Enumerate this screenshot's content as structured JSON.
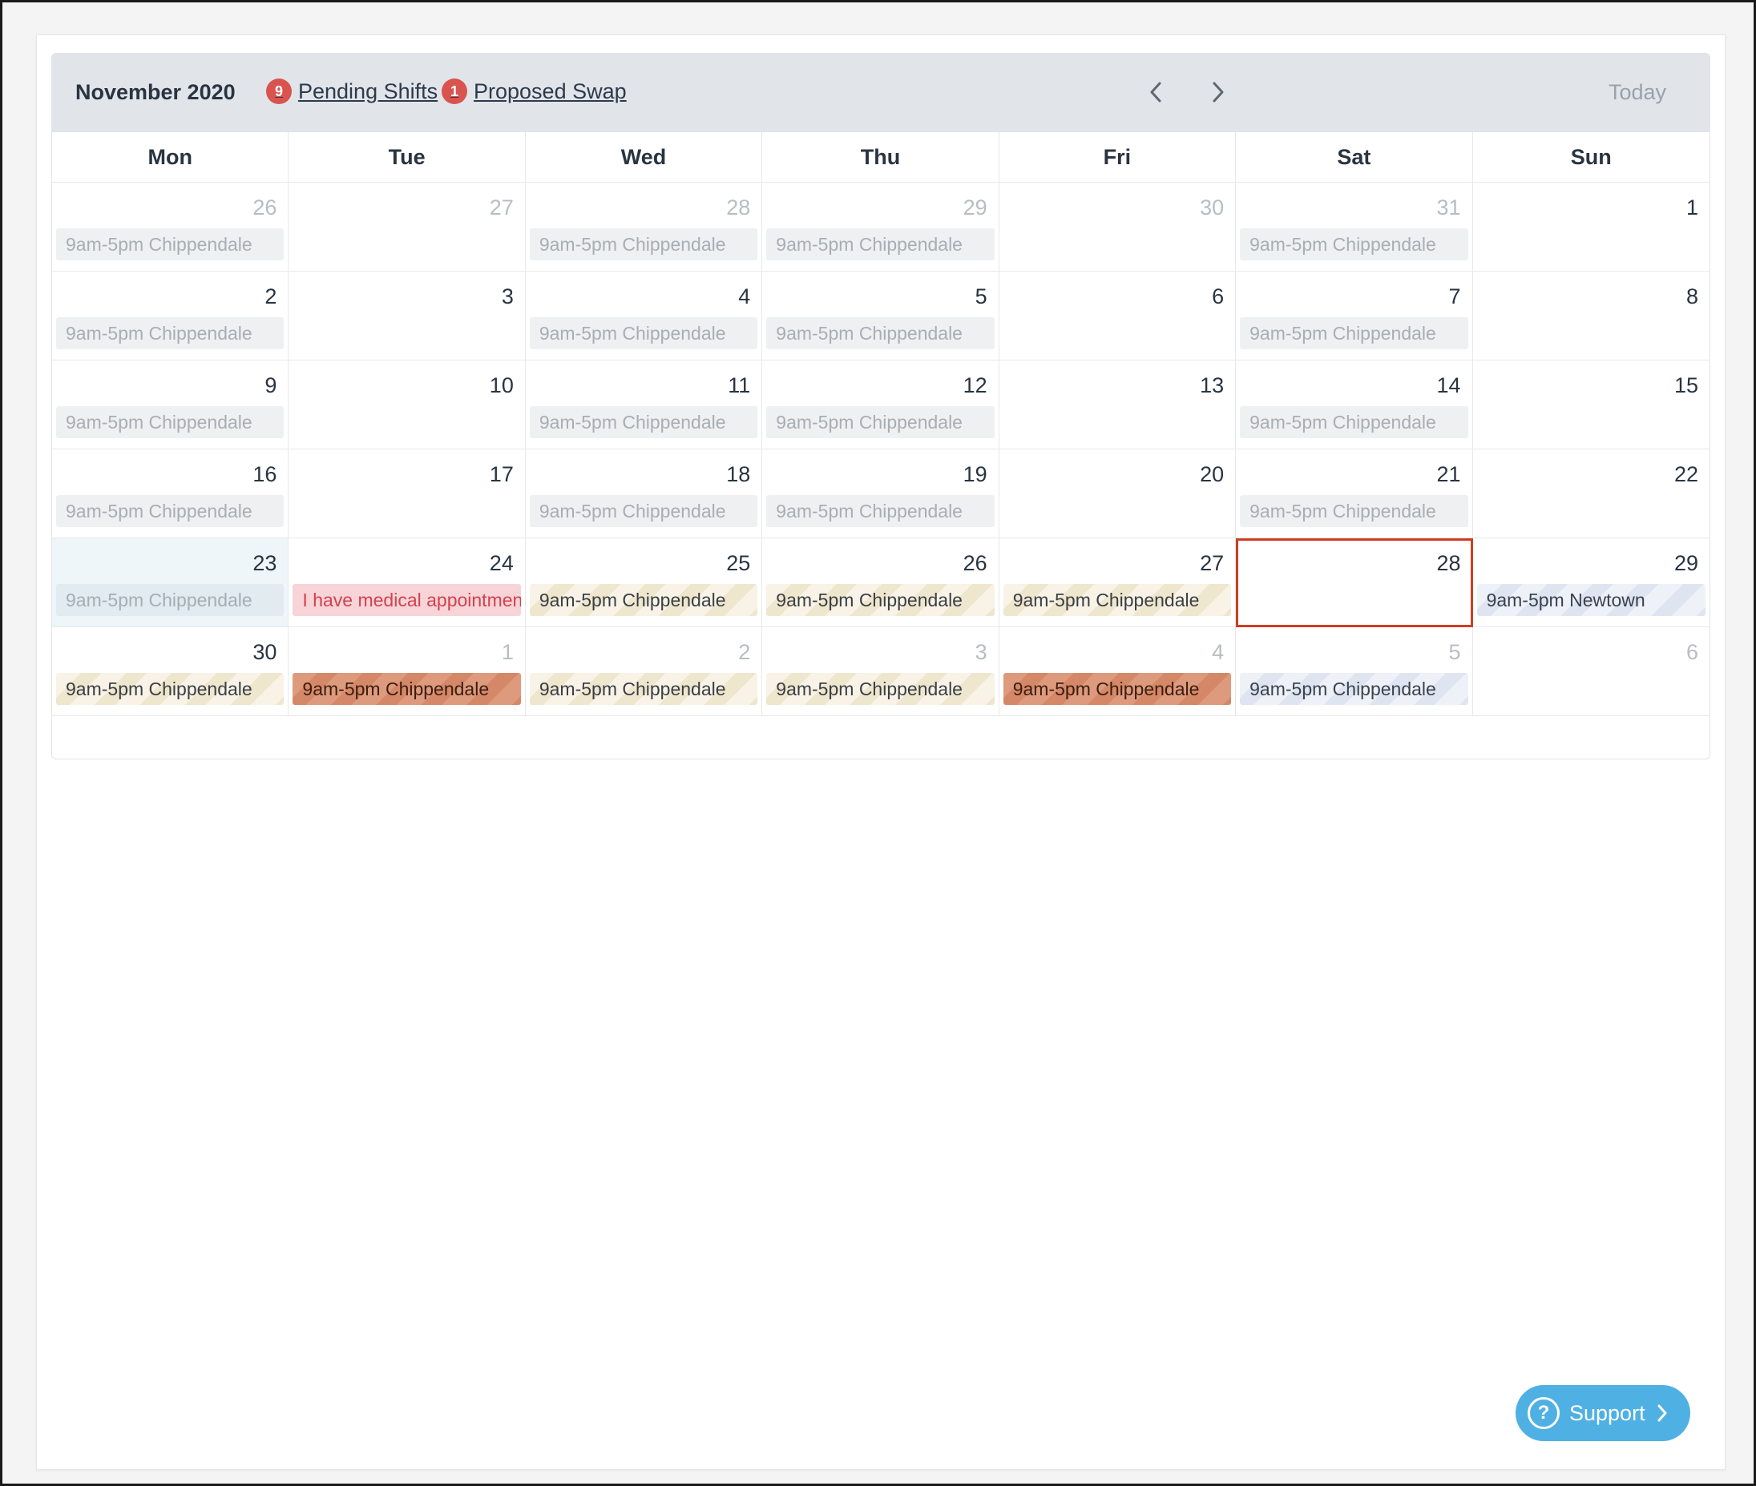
{
  "header": {
    "month_title": "November 2020",
    "pending": {
      "count": "9",
      "label": "Pending Shifts"
    },
    "proposed": {
      "count": "1",
      "label": "Proposed Swap"
    },
    "today_label": "Today"
  },
  "weekdays": [
    "Mon",
    "Tue",
    "Wed",
    "Thu",
    "Fri",
    "Sat",
    "Sun"
  ],
  "weeks": [
    [
      {
        "day": "26",
        "muted": true,
        "shift": "9am-5pm Chippendale",
        "kind": "past"
      },
      {
        "day": "27",
        "muted": true
      },
      {
        "day": "28",
        "muted": true,
        "shift": "9am-5pm Chippendale",
        "kind": "past"
      },
      {
        "day": "29",
        "muted": true,
        "shift": "9am-5pm Chippendale",
        "kind": "past"
      },
      {
        "day": "30",
        "muted": true
      },
      {
        "day": "31",
        "muted": true,
        "shift": "9am-5pm Chippendale",
        "kind": "past"
      },
      {
        "day": "1"
      }
    ],
    [
      {
        "day": "2",
        "shift": "9am-5pm Chippendale",
        "kind": "past"
      },
      {
        "day": "3"
      },
      {
        "day": "4",
        "shift": "9am-5pm Chippendale",
        "kind": "past"
      },
      {
        "day": "5",
        "shift": "9am-5pm Chippendale",
        "kind": "past"
      },
      {
        "day": "6"
      },
      {
        "day": "7",
        "shift": "9am-5pm Chippendale",
        "kind": "past"
      },
      {
        "day": "8"
      }
    ],
    [
      {
        "day": "9",
        "shift": "9am-5pm Chippendale",
        "kind": "past"
      },
      {
        "day": "10"
      },
      {
        "day": "11",
        "shift": "9am-5pm Chippendale",
        "kind": "past"
      },
      {
        "day": "12",
        "shift": "9am-5pm Chippendale",
        "kind": "past"
      },
      {
        "day": "13"
      },
      {
        "day": "14",
        "shift": "9am-5pm Chippendale",
        "kind": "past"
      },
      {
        "day": "15"
      }
    ],
    [
      {
        "day": "16",
        "shift": "9am-5pm Chippendale",
        "kind": "past"
      },
      {
        "day": "17"
      },
      {
        "day": "18",
        "shift": "9am-5pm Chippendale",
        "kind": "past"
      },
      {
        "day": "19",
        "shift": "9am-5pm Chippendale",
        "kind": "past"
      },
      {
        "day": "20"
      },
      {
        "day": "21",
        "shift": "9am-5pm Chippendale",
        "kind": "past"
      },
      {
        "day": "22"
      }
    ],
    [
      {
        "day": "23",
        "today": true,
        "shift": "9am-5pm Chippendale",
        "kind": "past today"
      },
      {
        "day": "24",
        "shift": "I have medical appointment",
        "kind": "note"
      },
      {
        "day": "25",
        "shift": "9am-5pm Chippendale",
        "kind": "pending"
      },
      {
        "day": "26",
        "shift": "9am-5pm Chippendale",
        "kind": "pending"
      },
      {
        "day": "27",
        "shift": "9am-5pm Chippendale",
        "kind": "pending"
      },
      {
        "day": "28",
        "selected": true
      },
      {
        "day": "29",
        "shift": "9am-5pm Newtown",
        "kind": "swap"
      }
    ],
    [
      {
        "day": "30",
        "shift": "9am-5pm Chippendale",
        "kind": "pending"
      },
      {
        "day": "1",
        "muted": true,
        "shift": "9am-5pm Chippendale",
        "kind": "proposed"
      },
      {
        "day": "2",
        "muted": true,
        "shift": "9am-5pm Chippendale",
        "kind": "pending"
      },
      {
        "day": "3",
        "muted": true,
        "shift": "9am-5pm Chippendale",
        "kind": "pending"
      },
      {
        "day": "4",
        "muted": true,
        "shift": "9am-5pm Chippendale",
        "kind": "proposed"
      },
      {
        "day": "5",
        "muted": true,
        "shift": "9am-5pm Chippendale",
        "kind": "swap"
      },
      {
        "day": "6",
        "muted": true
      }
    ]
  ],
  "support": {
    "label": "Support",
    "icon": "question-circle-icon"
  },
  "icons": {
    "prev": "chevron-left-icon",
    "next": "chevron-right-icon"
  },
  "colors": {
    "header_bg": "#e1e5ea",
    "badge": "#d9534f",
    "selected_outline": "#cf3e23",
    "proposed_shift": "#de9a7d",
    "support_button": "#4fb0e3"
  }
}
